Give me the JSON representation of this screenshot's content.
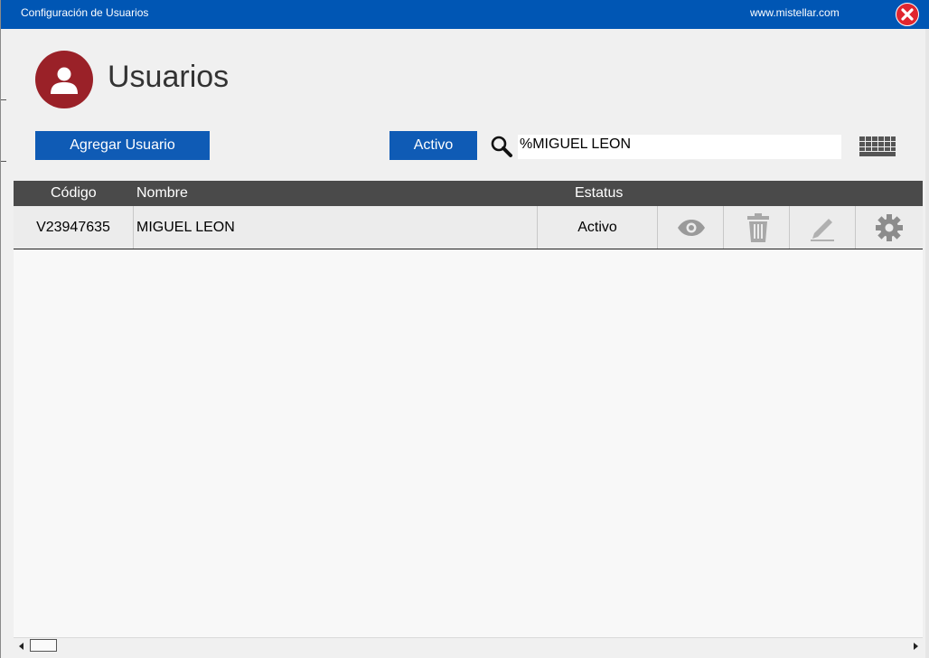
{
  "window": {
    "title": "Configuración de Usuarios",
    "url": "www.mistellar.com"
  },
  "page": {
    "heading": "Usuarios",
    "avatar_icon": "user-icon"
  },
  "toolbar": {
    "add_label": "Agregar Usuario",
    "status_filter": "Activo",
    "search_value": "%MIGUEL LEON",
    "search_icon": "search-icon",
    "keyboard_icon": "keyboard-icon"
  },
  "table": {
    "columns": [
      "Código",
      "Nombre",
      "Estatus"
    ],
    "rows": [
      {
        "codigo": "V23947635",
        "nombre": "MIGUEL LEON",
        "estatus": "Activo",
        "actions": [
          "eye-icon",
          "trash-icon",
          "pencil-icon",
          "gear-icon"
        ]
      }
    ]
  },
  "colors": {
    "titlebar": "#0056b4",
    "button": "#0f5bb5",
    "avatar": "#9a2128",
    "header": "#4a4a4a",
    "close": "#e0262f"
  }
}
